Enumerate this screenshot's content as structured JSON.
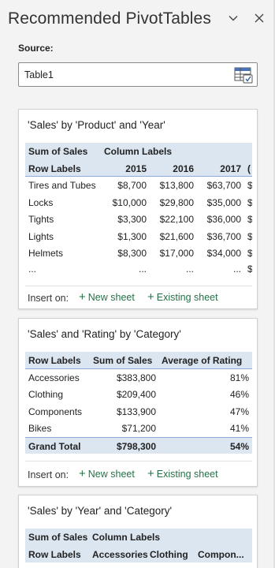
{
  "pane": {
    "title": "Recommended PivotTables",
    "source_label": "Source:",
    "source_value": "Table1"
  },
  "cards": [
    {
      "title": "'Sales' by 'Product' and 'Year'",
      "header1": [
        "Sum of Sales",
        "Column Labels"
      ],
      "header2": [
        "Row Labels",
        "2015",
        "2016",
        "2017",
        "("
      ],
      "rows": [
        [
          "Tires and Tubes",
          "$8,700",
          "$13,800",
          "$63,700",
          "$"
        ],
        [
          "Locks",
          "$10,000",
          "$29,800",
          "$35,000",
          "$"
        ],
        [
          "Tights",
          "$3,300",
          "$22,100",
          "$36,000",
          "$"
        ],
        [
          "Lights",
          "$1,300",
          "$21,600",
          "$36,700",
          "$"
        ],
        [
          "Helmets",
          "$8,300",
          "$17,000",
          "$34,000",
          "$"
        ],
        [
          "...",
          "...",
          "...",
          "...",
          "$"
        ]
      ],
      "insert_on": "Insert on:",
      "new_sheet": "New sheet",
      "existing_sheet": "Existing sheet"
    },
    {
      "title": "'Sales' and 'Rating' by 'Category'",
      "header": [
        "Row Labels",
        "Sum of Sales",
        "Average of Rating"
      ],
      "rows": [
        [
          "Accessories",
          "$383,800",
          "81%"
        ],
        [
          "Clothing",
          "$209,400",
          "46%"
        ],
        [
          "Components",
          "$133,900",
          "47%"
        ],
        [
          "Bikes",
          "$71,200",
          "41%"
        ]
      ],
      "total": [
        "Grand Total",
        "$798,300",
        "54%"
      ],
      "insert_on": "Insert on:",
      "new_sheet": "New sheet",
      "existing_sheet": "Existing sheet"
    },
    {
      "title": "'Sales' by 'Year' and 'Category'",
      "header1": [
        "Sum of Sales",
        "Column Labels"
      ],
      "header2": [
        "Row Labels",
        "Accessories",
        "Clothing",
        "Compon..."
      ]
    }
  ],
  "icons": {
    "collapse": "chevron-down-icon",
    "close": "close-icon",
    "range_picker": "range-select-icon",
    "add": "plus-icon"
  },
  "colors": {
    "accent_green": "#217346",
    "table_header_bg": "#dce6f1",
    "table_rule": "#8eaadb"
  }
}
